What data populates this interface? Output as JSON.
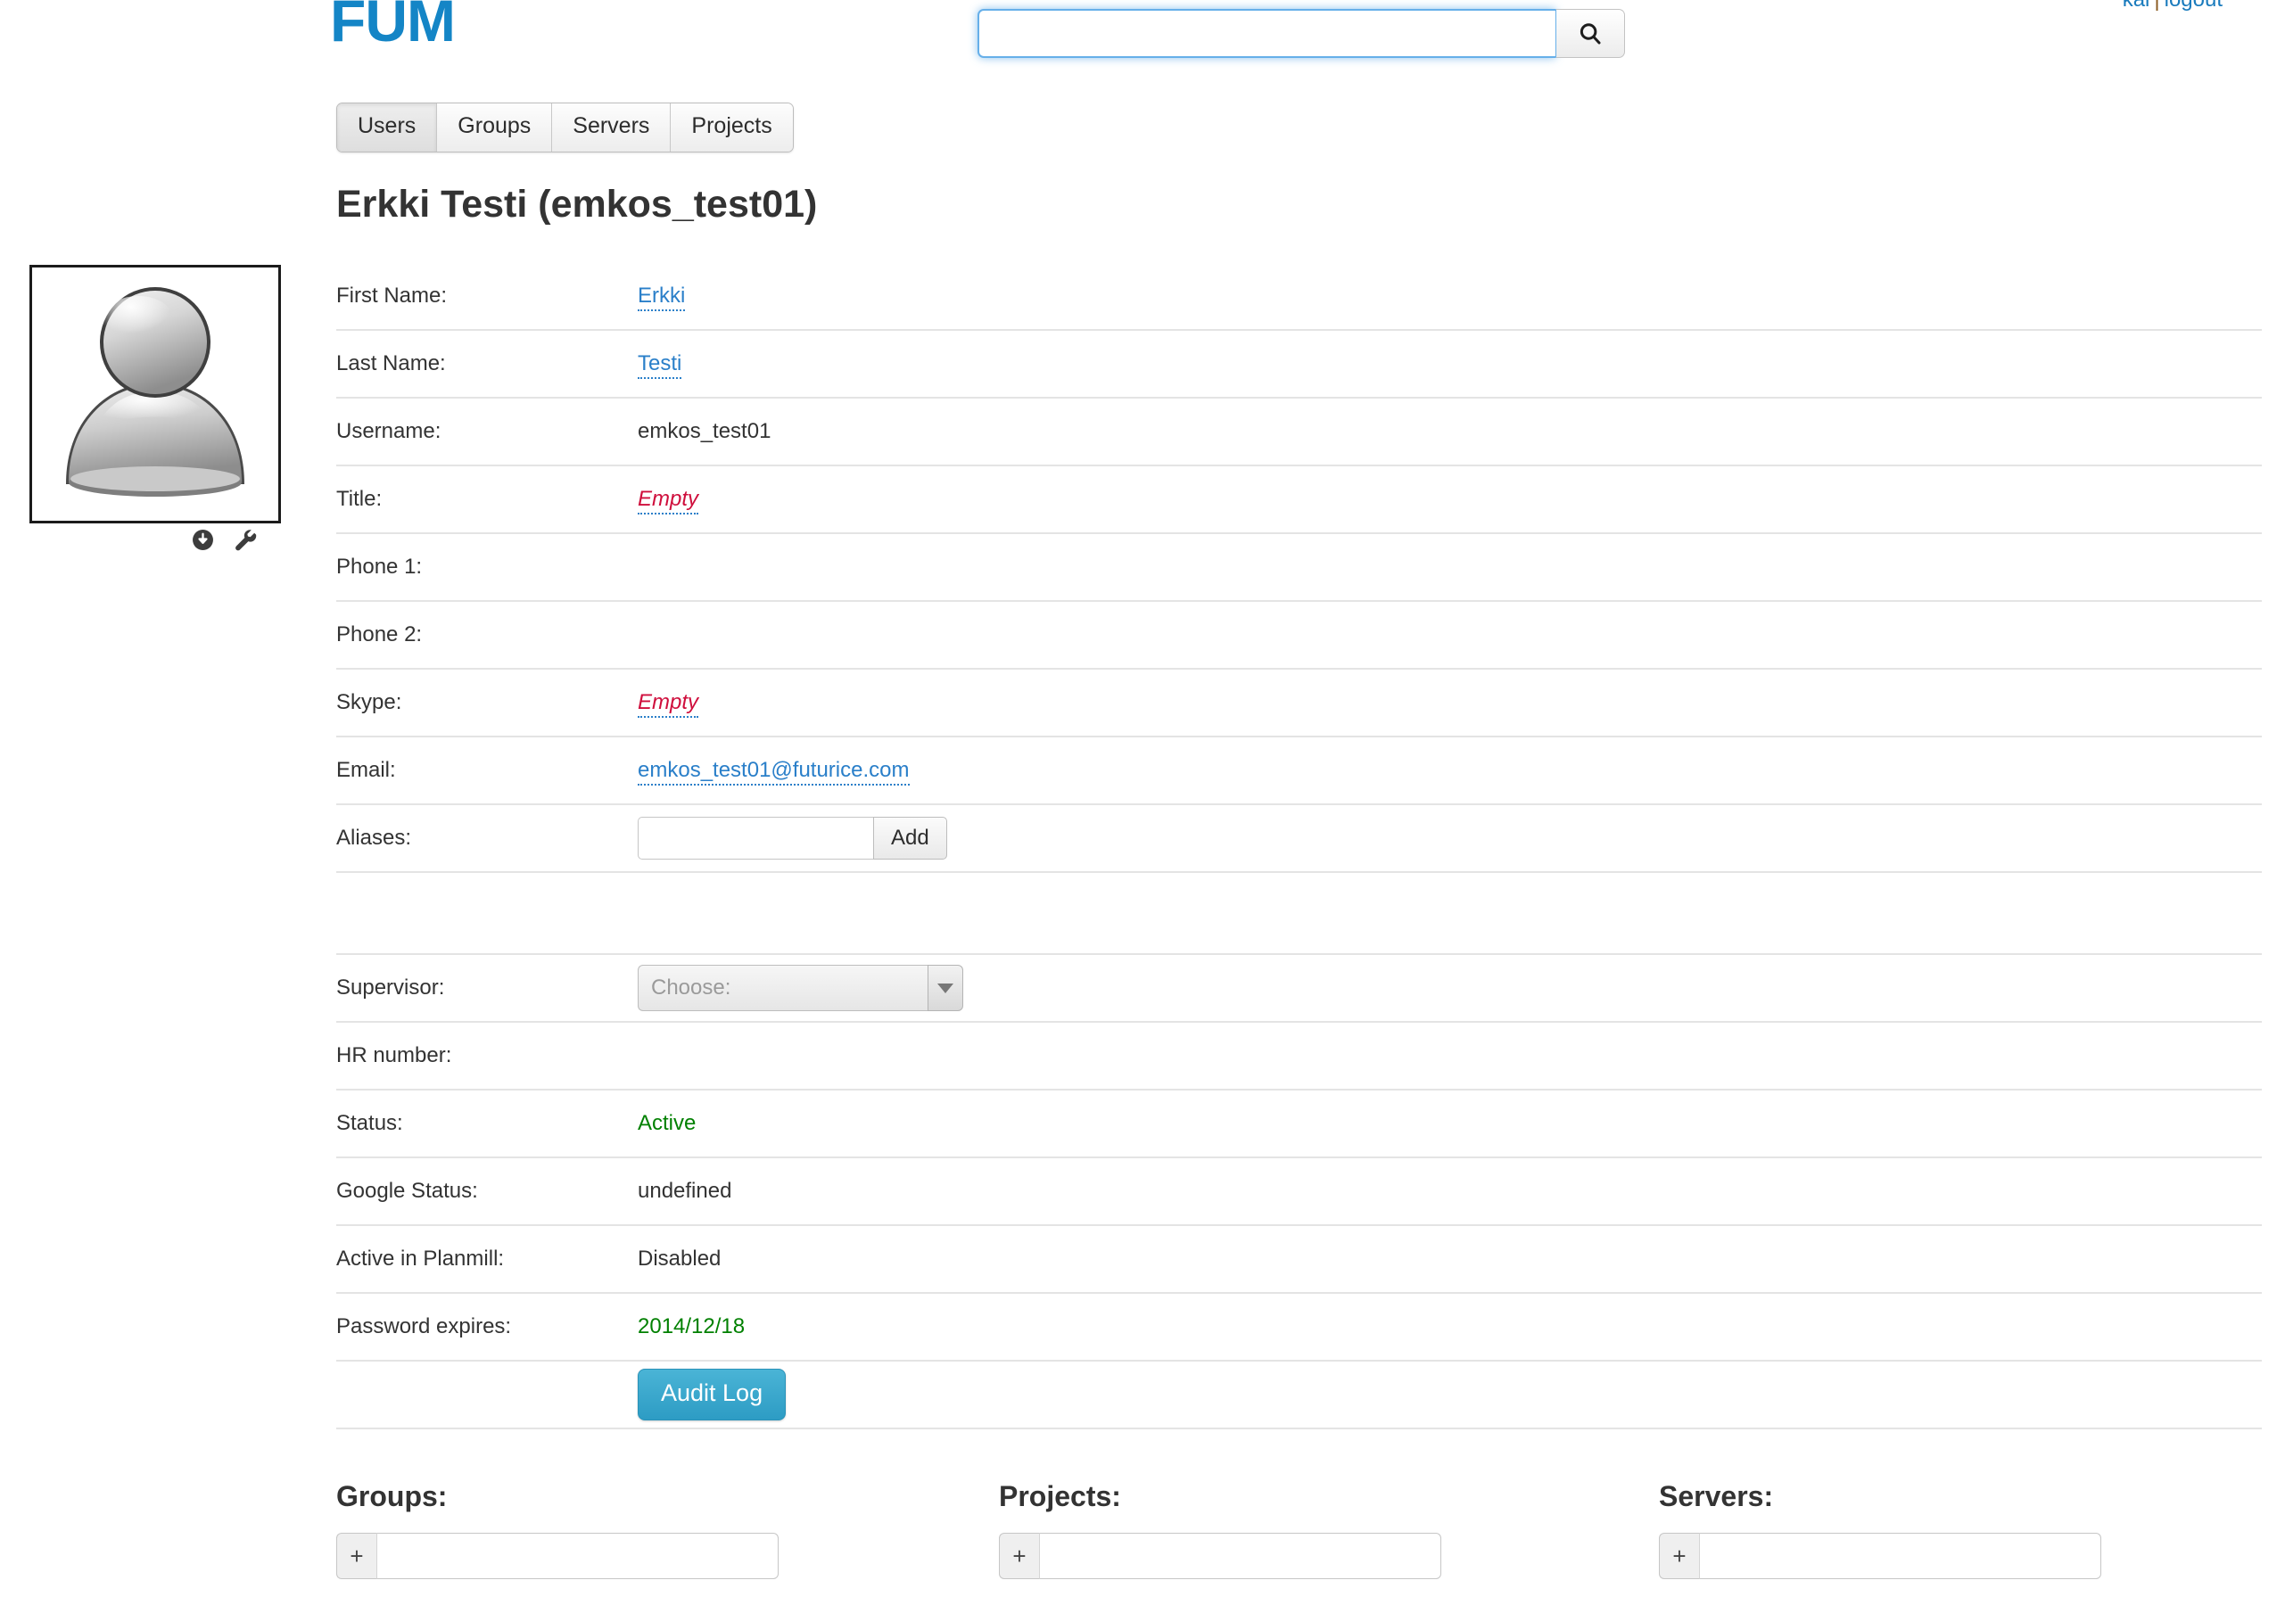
{
  "header": {
    "brand": "FUM",
    "account_user": "kai",
    "account_separator": "|",
    "account_logout": "logout"
  },
  "search": {
    "value": "",
    "placeholder": "",
    "icon": "search-icon"
  },
  "tabs": [
    {
      "label": "Users",
      "active": true
    },
    {
      "label": "Groups",
      "active": false
    },
    {
      "label": "Servers",
      "active": false
    },
    {
      "label": "Projects",
      "active": false
    }
  ],
  "page_title": "Erkki Testi (emkos_test01)",
  "avatar": {
    "icon": "default-user-avatar-icon",
    "download_icon": "download-circle-icon",
    "settings_icon": "wrench-icon"
  },
  "fields": {
    "first_name_label": "First Name:",
    "first_name_value": "Erkki",
    "last_name_label": "Last Name:",
    "last_name_value": "Testi",
    "username_label": "Username:",
    "username_value": "emkos_test01",
    "title_label": "Title:",
    "title_value": "Empty",
    "phone1_label": "Phone 1:",
    "phone1_value": "",
    "phone2_label": "Phone 2:",
    "phone2_value": "",
    "skype_label": "Skype:",
    "skype_value": "Empty",
    "email_label": "Email:",
    "email_value": "emkos_test01@futurice.com",
    "aliases_label": "Aliases:",
    "aliases_input_value": "",
    "aliases_add_label": "Add",
    "supervisor_label": "Supervisor:",
    "supervisor_value": "Choose:",
    "hr_number_label": "HR number:",
    "hr_number_value": "",
    "status_label": "Status:",
    "status_value": "Active",
    "google_status_label": "Google Status:",
    "google_status_value": "undefined",
    "planmill_label": "Active in Planmill:",
    "planmill_value": "Disabled",
    "password_expires_label": "Password expires:",
    "password_expires_value": "2014/12/18",
    "audit_log_label": "Audit Log"
  },
  "bottom": {
    "groups_title": "Groups:",
    "groups_add_label": "+",
    "groups_input_value": "",
    "projects_title": "Projects:",
    "projects_add_label": "+",
    "projects_input_value": "",
    "servers_title": "Servers:",
    "servers_add_label": "+",
    "servers_input_value": ""
  },
  "colors": {
    "brand": "#1485c6",
    "link": "#2a7fc9",
    "empty": "#cf0e3c",
    "active_green": "#008000",
    "audit_button": "#3aaacd"
  }
}
